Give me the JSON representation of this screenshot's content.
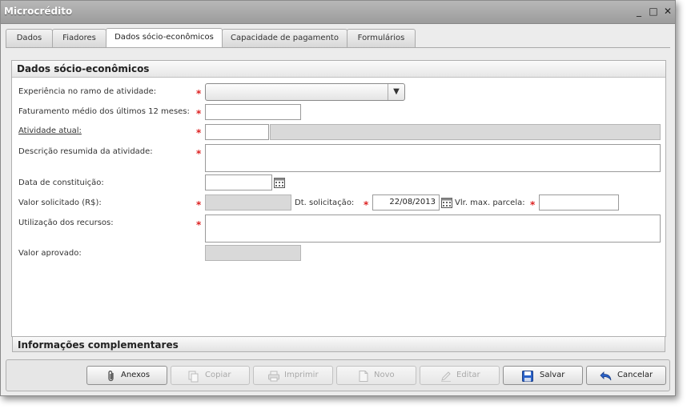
{
  "window": {
    "title": "Microcrédito",
    "minimize": "_",
    "maximize": "□",
    "close": "✕"
  },
  "tabs": [
    {
      "label": "Dados"
    },
    {
      "label": "Fiadores"
    },
    {
      "label": "Dados sócio-econômicos"
    },
    {
      "label": "Capacidade de pagamento"
    },
    {
      "label": "Formulários"
    }
  ],
  "active_tab": "Dados sócio-econômicos",
  "panel": {
    "title": "Dados sócio-econômicos",
    "required_marker": "*",
    "fields": {
      "experiencia": {
        "label": "Experiência no ramo de atividade:",
        "value": "",
        "arrow": "▼"
      },
      "faturamento": {
        "label": "Faturamento médio dos últimos 12 meses:",
        "value": ""
      },
      "atividade": {
        "label": "Atividade atual:",
        "code": "",
        "description": ""
      },
      "descricao": {
        "label": "Descrição resumida da atividade:",
        "value": ""
      },
      "data_constituicao": {
        "label": "Data de constituição:",
        "value": ""
      },
      "valor_solicitado": {
        "label": "Valor solicitado (R$):",
        "value": ""
      },
      "dt_solicitacao": {
        "label": "Dt. solicitação:",
        "value": "22/08/2013"
      },
      "vlr_max_parcela": {
        "label": "Vlr. max. parcela:",
        "value": ""
      },
      "utilizacao": {
        "label": "Utilização dos recursos:",
        "value": ""
      },
      "valor_aprovado": {
        "label": "Valor aprovado:",
        "value": ""
      }
    }
  },
  "sub_panel": {
    "title": "Informações complementares"
  },
  "footer": {
    "buttons": [
      {
        "label": "Anexos",
        "icon": "paperclip-icon",
        "enabled": true
      },
      {
        "label": "Copiar",
        "icon": "copy-icon",
        "enabled": false
      },
      {
        "label": "Imprimir",
        "icon": "printer-icon",
        "enabled": false
      },
      {
        "label": "Novo",
        "icon": "new-document-icon",
        "enabled": false
      },
      {
        "label": "Editar",
        "icon": "pencil-icon",
        "enabled": false
      },
      {
        "label": "Salvar",
        "icon": "floppy-disk-icon",
        "enabled": true
      },
      {
        "label": "Cancelar",
        "icon": "undo-arrow-icon",
        "enabled": true
      }
    ]
  },
  "colors": {
    "required": "#dd2222",
    "disabled_field": "#d9d9d9",
    "accent_blue": "#2a62c9"
  }
}
